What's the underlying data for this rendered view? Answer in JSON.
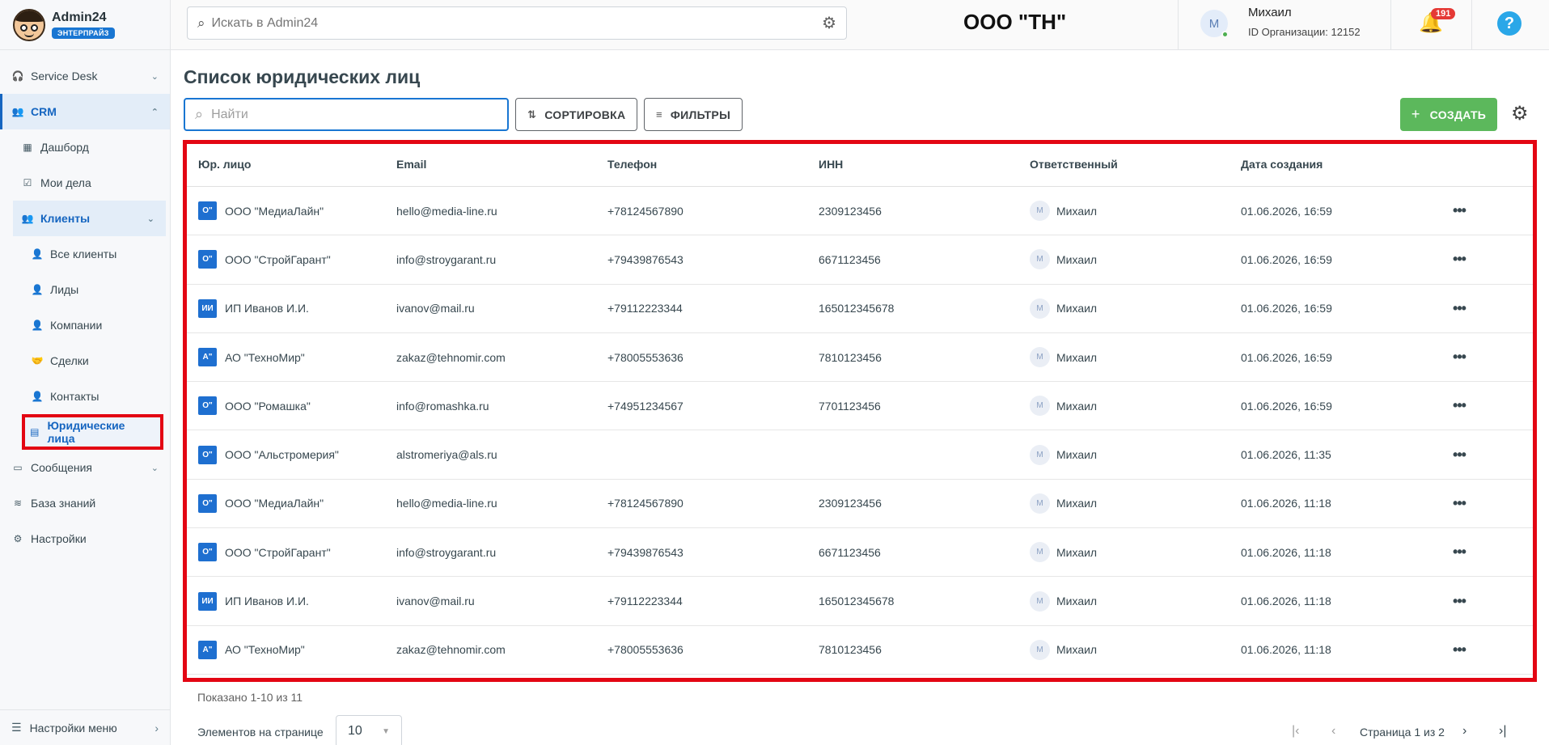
{
  "brand": {
    "name": "Admin24",
    "badge": "ЭНТЕРПРАЙЗ"
  },
  "sidebar": {
    "items": [
      {
        "label": "Service Desk",
        "icon": "headset-icon"
      },
      {
        "label": "CRM",
        "icon": "people-icon"
      },
      {
        "label": "Дашборд",
        "icon": "dashboard-icon"
      },
      {
        "label": "Мои дела",
        "icon": "calendar-check-icon"
      },
      {
        "label": "Клиенты",
        "icon": "people-icon"
      },
      {
        "label": "Все клиенты",
        "icon": "person-icon"
      },
      {
        "label": "Лиды",
        "icon": "person-icon"
      },
      {
        "label": "Компании",
        "icon": "person-icon"
      },
      {
        "label": "Сделки",
        "icon": "handshake-icon"
      },
      {
        "label": "Контакты",
        "icon": "person-icon"
      },
      {
        "label": "Юридические лица",
        "icon": "building-icon"
      },
      {
        "label": "Сообщения",
        "icon": "chat-icon"
      },
      {
        "label": "База знаний",
        "icon": "database-icon"
      },
      {
        "label": "Настройки",
        "icon": "gear-icon"
      }
    ],
    "bottom_label": "Настройки меню"
  },
  "header": {
    "search_placeholder": "Искать в Admin24",
    "org_title": "ООО \"ТН\"",
    "user_initial": "М",
    "user_name": "Михаил",
    "user_org": "ID Организации: 12152",
    "notifications": "191",
    "help": "?"
  },
  "main": {
    "title": "Список юридических лиц",
    "search_placeholder": "Найти",
    "sort_label": "СОРТИРОВКА",
    "filter_label": "ФИЛЬТРЫ",
    "create_label": "СОЗДАТЬ",
    "columns": [
      "Юр. лицо",
      "Email",
      "Телефон",
      "ИНН",
      "Ответственный",
      "Дата создания"
    ],
    "rows": [
      {
        "icon": "О\"",
        "name": "ООО \"МедиаЛайн\"",
        "email": "hello@media-line.ru",
        "phone": "+78124567890",
        "inn": "2309123456",
        "owner_initial": "М",
        "owner": "Михаил",
        "date": "01.06.2026, 16:59"
      },
      {
        "icon": "О\"",
        "name": "ООО \"СтройГарант\"",
        "email": "info@stroygarant.ru",
        "phone": "+79439876543",
        "inn": "6671123456",
        "owner_initial": "М",
        "owner": "Михаил",
        "date": "01.06.2026, 16:59"
      },
      {
        "icon": "ИИ",
        "name": "ИП Иванов И.И.",
        "email": "ivanov@mail.ru",
        "phone": "+79112223344",
        "inn": "165012345678",
        "owner_initial": "М",
        "owner": "Михаил",
        "date": "01.06.2026, 16:59"
      },
      {
        "icon": "А\"",
        "name": "АО \"ТехноМир\"",
        "email": "zakaz@tehnomir.com",
        "phone": "+78005553636",
        "inn": "7810123456",
        "owner_initial": "М",
        "owner": "Михаил",
        "date": "01.06.2026, 16:59"
      },
      {
        "icon": "О\"",
        "name": "ООО \"Ромашка\"",
        "email": "info@romashka.ru",
        "phone": "+74951234567",
        "inn": "7701123456",
        "owner_initial": "М",
        "owner": "Михаил",
        "date": "01.06.2026, 16:59"
      },
      {
        "icon": "О\"",
        "name": "ООО \"Альстромерия\"",
        "email": "alstromeriya@als.ru",
        "phone": "",
        "inn": "",
        "owner_initial": "М",
        "owner": "Михаил",
        "date": "01.06.2026, 11:35"
      },
      {
        "icon": "О\"",
        "name": "ООО \"МедиаЛайн\"",
        "email": "hello@media-line.ru",
        "phone": "+78124567890",
        "inn": "2309123456",
        "owner_initial": "М",
        "owner": "Михаил",
        "date": "01.06.2026, 11:18"
      },
      {
        "icon": "О\"",
        "name": "ООО \"СтройГарант\"",
        "email": "info@stroygarant.ru",
        "phone": "+79439876543",
        "inn": "6671123456",
        "owner_initial": "М",
        "owner": "Михаил",
        "date": "01.06.2026, 11:18"
      },
      {
        "icon": "ИИ",
        "name": "ИП Иванов И.И.",
        "email": "ivanov@mail.ru",
        "phone": "+79112223344",
        "inn": "165012345678",
        "owner_initial": "М",
        "owner": "Михаил",
        "date": "01.06.2026, 11:18"
      },
      {
        "icon": "А\"",
        "name": "АО \"ТехноМир\"",
        "email": "zakaz@tehnomir.com",
        "phone": "+78005553636",
        "inn": "7810123456",
        "owner_initial": "М",
        "owner": "Михаил",
        "date": "01.06.2026, 11:18"
      }
    ],
    "row_menu": "•••",
    "shown": "Показано 1-10 из 11",
    "per_page_label": "Элементов на странице",
    "per_page_value": "10",
    "page_text": "Страница 1 из 2"
  },
  "colors": {
    "accent": "#1565c0",
    "create": "#5cb85c",
    "highlight": "#e30613"
  }
}
